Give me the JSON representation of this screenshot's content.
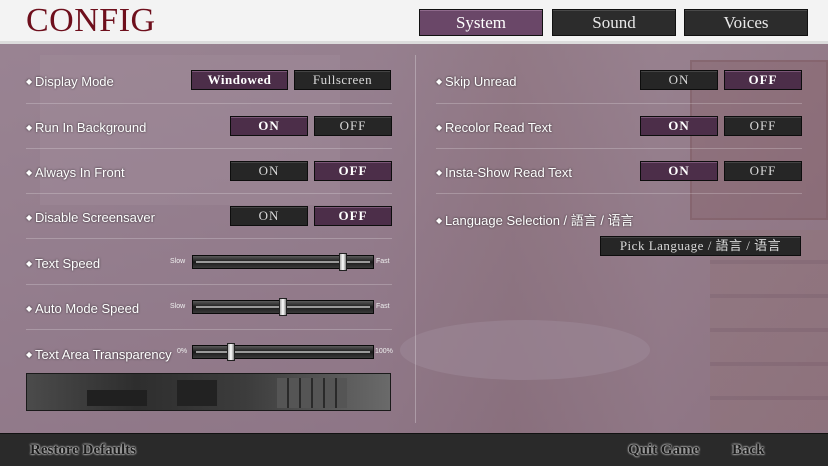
{
  "header": {
    "title": "CONFIG",
    "tabs": [
      {
        "label": "System",
        "active": true
      },
      {
        "label": "Sound",
        "active": false
      },
      {
        "label": "Voices",
        "active": false
      }
    ]
  },
  "left_options": [
    {
      "label": "Display Mode",
      "choices": [
        "Windowed",
        "Fullscreen"
      ],
      "selected": "Windowed"
    },
    {
      "label": "Run In Background",
      "choices": [
        "ON",
        "OFF"
      ],
      "selected": "ON"
    },
    {
      "label": "Always In Front",
      "choices": [
        "ON",
        "OFF"
      ],
      "selected": "OFF"
    },
    {
      "label": "Disable Screensaver",
      "choices": [
        "ON",
        "OFF"
      ],
      "selected": "OFF"
    }
  ],
  "sliders": [
    {
      "label": "Text Speed",
      "min_label": "Slow",
      "max_label": "Fast",
      "value": 0.85
    },
    {
      "label": "Auto Mode Speed",
      "min_label": "Slow",
      "max_label": "Fast",
      "value": 0.5
    },
    {
      "label": "Text Area Transparency",
      "min_label": "0%",
      "max_label": "100%",
      "value": 0.2
    }
  ],
  "right_options": [
    {
      "label": "Skip Unread",
      "choices": [
        "ON",
        "OFF"
      ],
      "selected": "OFF"
    },
    {
      "label": "Recolor Read Text",
      "choices": [
        "ON",
        "OFF"
      ],
      "selected": "ON"
    },
    {
      "label": "Insta-Show Read Text",
      "choices": [
        "ON",
        "OFF"
      ],
      "selected": "ON"
    }
  ],
  "language": {
    "label": "Language Selection / 語言 / 语言",
    "button_label": "Pick Language / 語言 / 语言"
  },
  "footer": {
    "restore_defaults": "Restore Defaults",
    "quit_game": "Quit Game",
    "back": "Back"
  },
  "colors": {
    "title": "#6e0f1c",
    "active_tab": "#6a4768",
    "selected_button": "#4c2e49",
    "unselected_button": "#262626"
  }
}
